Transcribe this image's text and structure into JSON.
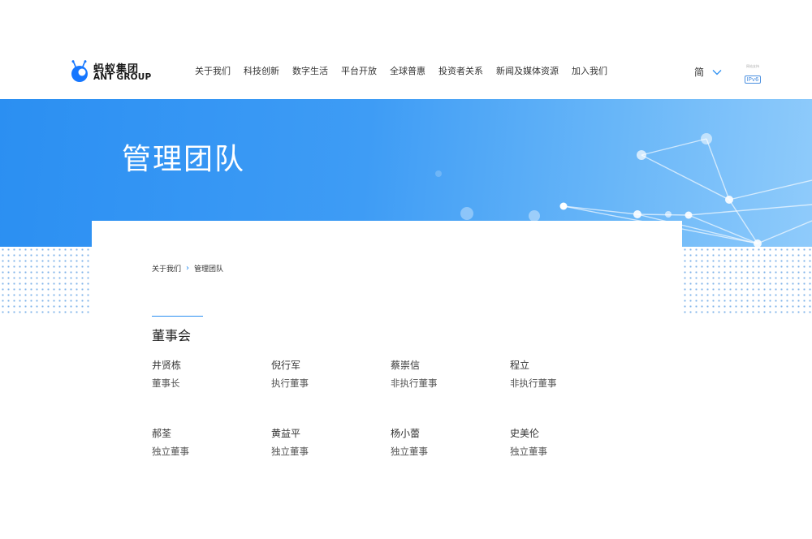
{
  "brand": {
    "name_cn": "蚂蚁集团",
    "name_en": "ANT GROUP",
    "accent_color": "#2b8ff2"
  },
  "nav": {
    "items": [
      {
        "label": "关于我们"
      },
      {
        "label": "科技创新"
      },
      {
        "label": "数字生活"
      },
      {
        "label": "平台开放"
      },
      {
        "label": "全球普惠"
      },
      {
        "label": "投资者关系"
      },
      {
        "label": "新闻及媒体资源"
      },
      {
        "label": "加入我们"
      }
    ],
    "language": "简",
    "ipv6_caption": "网站支持",
    "ipv6_badge": "IPv6"
  },
  "banner": {
    "title": "管理团队"
  },
  "breadcrumb": {
    "parent": "关于我们",
    "current": "管理团队"
  },
  "section": {
    "title": "董事会",
    "members": [
      {
        "name": "井贤栋",
        "role": "董事长"
      },
      {
        "name": "倪行军",
        "role": "执行董事"
      },
      {
        "name": "蔡崇信",
        "role": "非执行董事"
      },
      {
        "name": "程立",
        "role": "非执行董事"
      },
      {
        "name": "郝荃",
        "role": "独立董事"
      },
      {
        "name": "黄益平",
        "role": "独立董事"
      },
      {
        "name": "杨小蕾",
        "role": "独立董事"
      },
      {
        "name": "史美伦",
        "role": "独立董事"
      }
    ]
  }
}
